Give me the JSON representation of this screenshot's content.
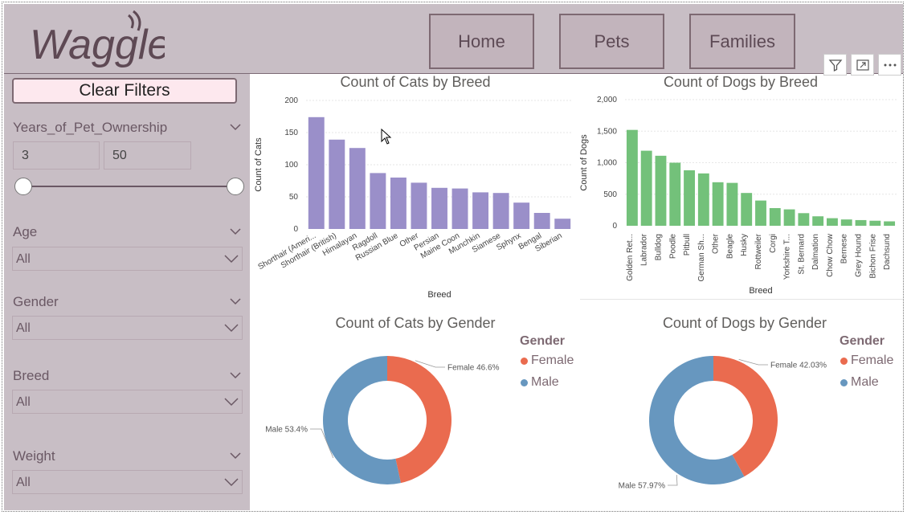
{
  "header": {
    "logo_text": "Waggle",
    "nav": [
      {
        "label": "Home"
      },
      {
        "label": "Pets"
      },
      {
        "label": "Families"
      }
    ],
    "tools": [
      "filter-icon",
      "focus-mode-icon",
      "more-options-icon"
    ]
  },
  "sidebar": {
    "clear_label": "Clear Filters",
    "years": {
      "label": "Years_of_Pet_Ownership",
      "min": "3",
      "max": "50"
    },
    "age": {
      "label": "Age",
      "value": "All"
    },
    "gender": {
      "label": "Gender",
      "value": "All"
    },
    "breed": {
      "label": "Breed",
      "value": "All"
    },
    "weight": {
      "label": "Weight",
      "value": "All"
    }
  },
  "chart_data": [
    {
      "type": "bar",
      "title": "Count of Cats by Breed",
      "xlabel": "Breed",
      "ylabel": "Count of Cats",
      "ylim": [
        0,
        200
      ],
      "yticks": [
        "0",
        "50",
        "100",
        "150",
        "200"
      ],
      "color": "#9a8fc9",
      "categories": [
        "Shorthair (Ameri...",
        "Shorthair (British)",
        "Himalayan",
        "Ragdoll",
        "Russian Blue",
        "Other",
        "Persian",
        "Maine Coon",
        "Munchkin",
        "Siamese",
        "Sphynx",
        "Bengal",
        "Siberian"
      ],
      "values": [
        174,
        139,
        126,
        87,
        80,
        72,
        64,
        63,
        57,
        56,
        41,
        25,
        16
      ]
    },
    {
      "type": "bar",
      "title": "Count of Dogs by Breed",
      "xlabel": "Breed",
      "ylabel": "Count of Dogs",
      "ylim": [
        0,
        2000
      ],
      "yticks": [
        "0",
        "500",
        "1,000",
        "1,500",
        "2,000"
      ],
      "color": "#73c17a",
      "categories": [
        "Golden Ret...",
        "Labrador",
        "Bulldog",
        "Poodle",
        "Pitbull",
        "German Sh...",
        "Other",
        "Beagle",
        "Husky",
        "Rottweiler",
        "Corgi",
        "Yorkshire T...",
        "St. Bernard",
        "Dalmation",
        "Chow Chow",
        "Bernese",
        "Grey Hound",
        "Bichon Frise",
        "Dachsund"
      ],
      "values": [
        1520,
        1190,
        1110,
        1000,
        880,
        830,
        690,
        680,
        520,
        400,
        280,
        260,
        200,
        150,
        120,
        100,
        90,
        80,
        70
      ]
    },
    {
      "type": "pie",
      "title": "Count of Cats by Gender",
      "legend_title": "Gender",
      "slices": [
        {
          "name": "Female",
          "value": 46.6,
          "label": "Female 46.6%",
          "color": "#ea6b4f"
        },
        {
          "name": "Male",
          "value": 53.4,
          "label": "Male 53.4%",
          "color": "#6797bf"
        }
      ]
    },
    {
      "type": "pie",
      "title": "Count of Dogs by Gender",
      "legend_title": "Gender",
      "slices": [
        {
          "name": "Female",
          "value": 42.03,
          "label": "Female 42.03%",
          "color": "#ea6b4f"
        },
        {
          "name": "Male",
          "value": 57.97,
          "label": "Male 57.97%",
          "color": "#6797bf"
        }
      ]
    }
  ]
}
